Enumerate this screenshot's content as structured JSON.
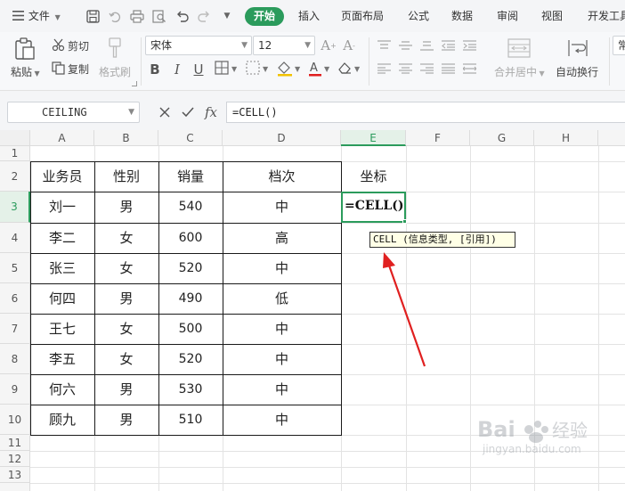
{
  "menubar": {
    "file_label": "文件",
    "tabs": [
      "开始",
      "插入",
      "页面布局",
      "公式",
      "数据",
      "审阅",
      "视图",
      "开发工具"
    ]
  },
  "ribbon": {
    "paste_label": "粘贴",
    "cut_label": "剪切",
    "copy_label": "复制",
    "format_painter_label": "格式刷",
    "font_name": "宋体",
    "font_size": "12",
    "merge_center_label": "合并居中",
    "wrap_text_label": "自动换行",
    "overflow_label": "常"
  },
  "formula_bar": {
    "name_box": "CEILING",
    "formula": "=CELL()"
  },
  "grid": {
    "columns": [
      "A",
      "B",
      "C",
      "D",
      "E",
      "F",
      "G",
      "H"
    ],
    "rows": [
      "1",
      "2",
      "3",
      "4",
      "5",
      "6",
      "7",
      "8",
      "9",
      "10",
      "11",
      "12",
      "13"
    ],
    "active_column": "E",
    "active_row": "3"
  },
  "table": {
    "headers": [
      "业务员",
      "性别",
      "销量",
      "档次"
    ],
    "e_header": "坐标",
    "rows": [
      [
        "刘一",
        "男",
        "540",
        "中"
      ],
      [
        "李二",
        "女",
        "600",
        "高"
      ],
      [
        "张三",
        "女",
        "520",
        "中"
      ],
      [
        "何四",
        "男",
        "490",
        "低"
      ],
      [
        "王七",
        "女",
        "500",
        "中"
      ],
      [
        "李五",
        "女",
        "520",
        "中"
      ],
      [
        "何六",
        "男",
        "530",
        "中"
      ],
      [
        "顾九",
        "男",
        "510",
        "中"
      ]
    ]
  },
  "active_cell": {
    "text": "=CELL()"
  },
  "tooltip": {
    "text": "CELL (信息类型, [引用])"
  },
  "colors": {
    "accent": "#2b9b5c",
    "annotation_arrow": "#e02020"
  }
}
